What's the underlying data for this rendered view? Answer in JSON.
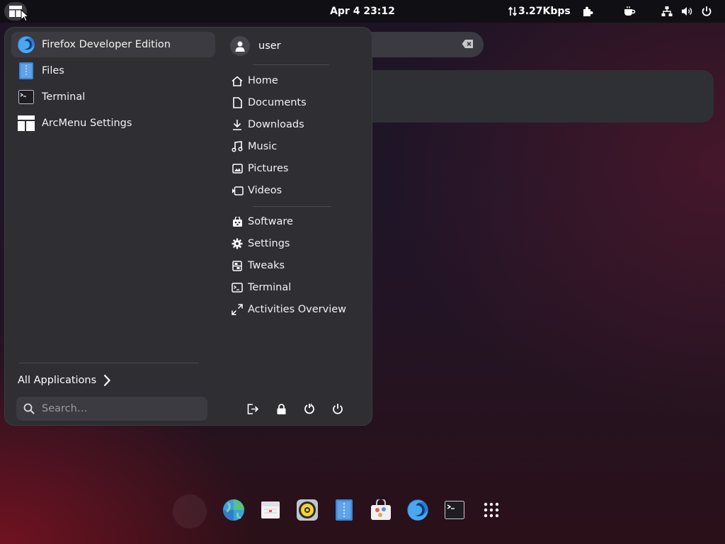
{
  "topbar": {
    "clock": "Apr 4  23:12",
    "net_speed": "3.27Kbps",
    "icons": [
      "arcmenu-icon",
      "extensions-icon",
      "caffeine-icon",
      "network-icon",
      "volume-icon",
      "power-icon"
    ]
  },
  "menu": {
    "apps": [
      {
        "label": "Firefox Developer Edition",
        "icon": "firefox-dev-icon"
      },
      {
        "label": "Files",
        "icon": "files-icon"
      },
      {
        "label": "Terminal",
        "icon": "terminal-icon"
      },
      {
        "label": "ArcMenu Settings",
        "icon": "arcmenu-settings-icon"
      }
    ],
    "user": "user",
    "places": [
      {
        "label": "Home",
        "icon": "home-icon"
      },
      {
        "label": "Documents",
        "icon": "documents-icon"
      },
      {
        "label": "Downloads",
        "icon": "downloads-icon"
      },
      {
        "label": "Music",
        "icon": "music-icon"
      },
      {
        "label": "Pictures",
        "icon": "pictures-icon"
      },
      {
        "label": "Videos",
        "icon": "videos-icon"
      }
    ],
    "system": [
      {
        "label": "Software",
        "icon": "software-icon"
      },
      {
        "label": "Settings",
        "icon": "settings-icon"
      },
      {
        "label": "Tweaks",
        "icon": "tweaks-icon"
      },
      {
        "label": "Terminal",
        "icon": "terminal-small-icon"
      },
      {
        "label": "Activities Overview",
        "icon": "activities-icon"
      }
    ],
    "all_applications": "All Applications",
    "search_placeholder": "Search…",
    "power_buttons": [
      "log-out-icon",
      "lock-icon",
      "restart-icon",
      "power-off-icon"
    ]
  },
  "dock": {
    "items": [
      "web-browser-icon",
      "calendar-icon",
      "rhythmbox-icon",
      "files-dock-icon",
      "software-dock-icon",
      "firefox-dock-icon",
      "terminal-dock-icon",
      "show-apps-icon"
    ]
  },
  "colors": {
    "menu_bg": "#2e2e33",
    "topbar_bg": "#101014",
    "highlight": "#3b3b41"
  }
}
